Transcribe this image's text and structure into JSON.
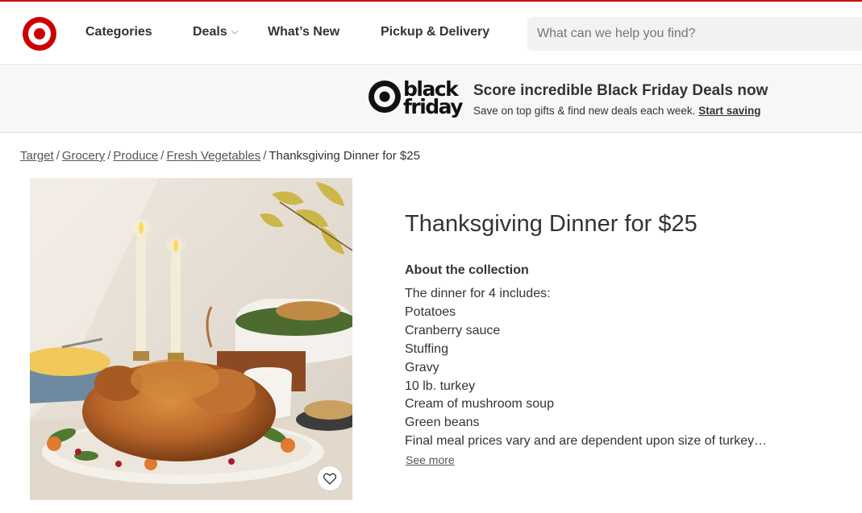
{
  "header": {
    "nav": [
      {
        "label": "Categories"
      },
      {
        "label": "Deals"
      },
      {
        "label": "What’s New"
      },
      {
        "label": "Pickup & Delivery"
      }
    ],
    "search_placeholder": "What can we help you find?"
  },
  "banner": {
    "logo_text_1": "black",
    "logo_text_2": "friday",
    "title": "Score incredible Black Friday Deals now",
    "subtitle": "Save on top gifts & find new deals each week.",
    "link": "Start saving"
  },
  "breadcrumb": {
    "links": [
      "Target",
      "Grocery",
      "Produce",
      "Fresh Vegetables"
    ],
    "separator": "/",
    "current": "Thanksgiving Dinner for $25"
  },
  "product": {
    "title": "Thanksgiving Dinner for $25",
    "about_heading": "About the collection",
    "description_lines": [
      "The dinner for 4 includes:",
      "Potatoes",
      "Cranberry sauce",
      "Stuffing",
      "Gravy",
      "10 lb. turkey",
      "Cream of mushroom soup",
      "Green beans",
      "Final meal prices vary and are dependent upon size of turkey…"
    ],
    "see_more": "See more"
  },
  "colors": {
    "brand_red": "#cc0000",
    "text": "#333333",
    "banner_bg": "#f7f7f7",
    "search_bg": "#f2f2f2"
  },
  "icons": {
    "logo": "target-bullseye-icon",
    "deals_chevron": "chevron-down-icon",
    "favorite": "heart-icon"
  }
}
